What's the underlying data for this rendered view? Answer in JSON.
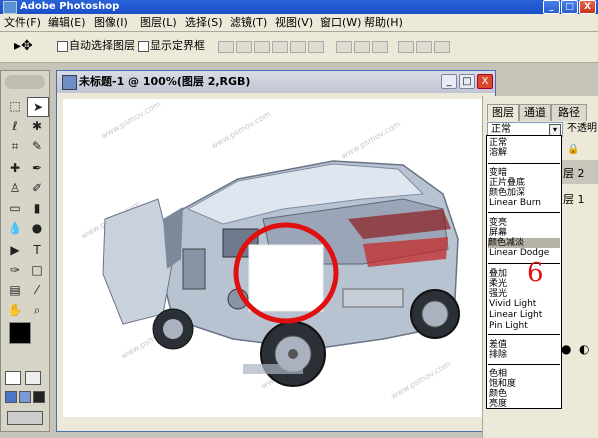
{
  "app": {
    "title": "Adobe Photoshop"
  },
  "window_controls": {
    "minimize": "_",
    "maximize": "□",
    "close": "X"
  },
  "menu": [
    "文件(F)",
    "编辑(E)",
    "图像(I)",
    "图层(L)",
    "选择(S)",
    "滤镜(T)",
    "视图(V)",
    "窗口(W)",
    "帮助(H)"
  ],
  "options": {
    "auto_select_label": "自动选择图层",
    "show_bounds_label": "显示定界框"
  },
  "document": {
    "title": "未标题-1 @ 100%(图层 2,RGB)"
  },
  "watermark": "www.psmov.com",
  "annotation_number": "6",
  "panel": {
    "tabs": [
      "图层",
      "通道",
      "路径"
    ],
    "blend_mode_selected": "正常",
    "opacity_label": "不透明",
    "layers": [
      "层 2",
      "层 1"
    ]
  },
  "blend_modes": {
    "group1": [
      "正常",
      "溶解"
    ],
    "group2": [
      "变暗",
      "正片叠底",
      "颜色加深",
      "Linear Burn"
    ],
    "group3": [
      "变亮",
      "屏幕",
      "颜色减淡",
      "Linear Dodge"
    ],
    "group4": [
      "叠加",
      "柔光",
      "强光",
      "Vivid Light",
      "Linear Light",
      "Pin Light"
    ],
    "group5": [
      "差值",
      "排除"
    ],
    "group6": [
      "色相",
      "饱和度",
      "颜色",
      "亮度"
    ],
    "highlighted": "颜色减淡"
  },
  "colors": {
    "title_bar": "#1a4fc8",
    "close_button": "#d23c1e",
    "red_annotation": "#e01010"
  }
}
